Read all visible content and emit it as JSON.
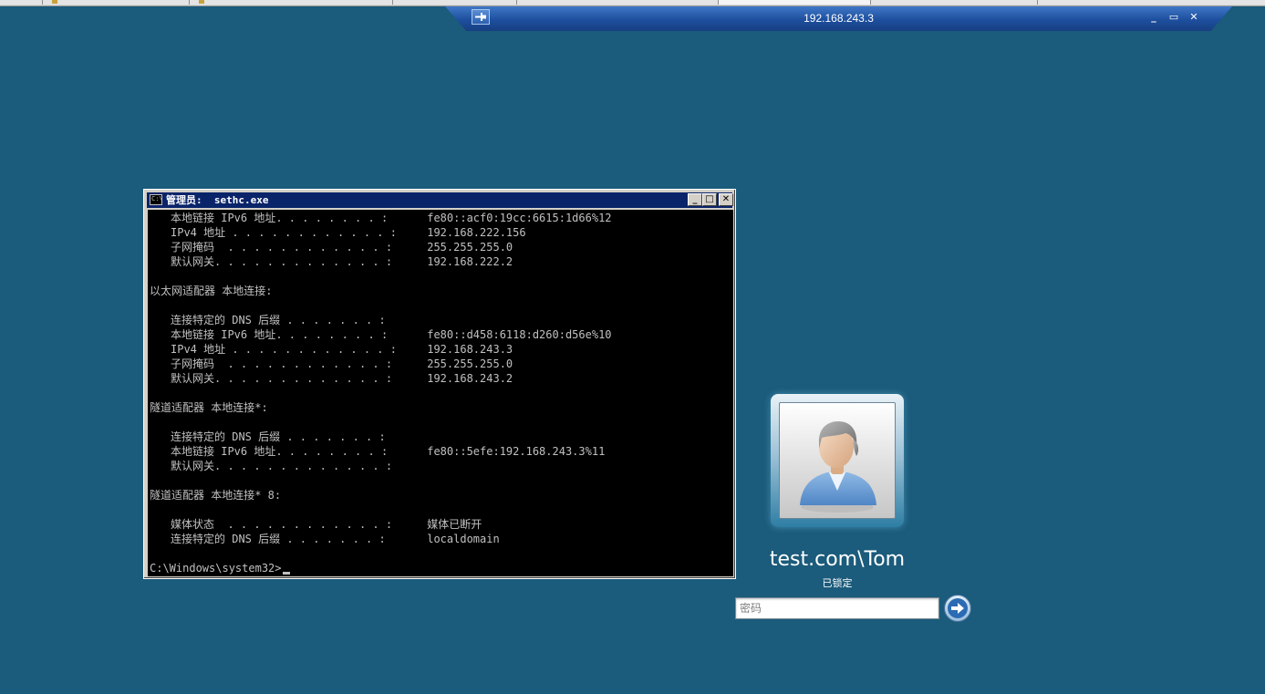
{
  "rdp_bar": {
    "title": "192.168.243.3",
    "pin_icon": "pin-icon",
    "minimize_glyph": "_",
    "restore_glyph": "▭",
    "close_glyph": "✕"
  },
  "cmd_window": {
    "icon_text": "C:\\",
    "title": "管理员:  sethc.exe",
    "minimize_glyph": "_",
    "maximize_glyph": "□",
    "close_glyph": "✕",
    "lines": {
      "l1_label": "本地链接 IPv6 地址. . . . . . . . :",
      "l1_value": "fe80::acf0:19cc:6615:1d66%12",
      "l2_label": "IPv4 地址 . . . . . . . . . . . . :",
      "l2_value": "192.168.222.156",
      "l3_label": "子网掩码  . . . . . . . . . . . . :",
      "l3_value": "255.255.255.0",
      "l4_label": "默认网关. . . . . . . . . . . . . :",
      "l4_value": "192.168.222.2",
      "h2": "以太网适配器 本地连接:",
      "l5_label": "连接特定的 DNS 后缀 . . . . . . . :",
      "l5_value": "",
      "l6_label": "本地链接 IPv6 地址. . . . . . . . :",
      "l6_value": "fe80::d458:6118:d260:d56e%10",
      "l7_label": "IPv4 地址 . . . . . . . . . . . . :",
      "l7_value": "192.168.243.3",
      "l8_label": "子网掩码  . . . . . . . . . . . . :",
      "l8_value": "255.255.255.0",
      "l9_label": "默认网关. . . . . . . . . . . . . :",
      "l9_value": "192.168.243.2",
      "h3": "隧道适配器 本地连接*:",
      "l10_label": "连接特定的 DNS 后缀 . . . . . . . :",
      "l10_value": "",
      "l11_label": "本地链接 IPv6 地址. . . . . . . . :",
      "l11_value": "fe80::5efe:192.168.243.3%11",
      "l12_label": "默认网关. . . . . . . . . . . . . :",
      "l12_value": "",
      "h4": "隧道适配器 本地连接* 8:",
      "l13_label": "媒体状态  . . . . . . . . . . . . :",
      "l13_value": "媒体已断开",
      "l14_label": "连接特定的 DNS 后缀 . . . . . . . :",
      "l14_value": "localdomain",
      "prompt": "C:\\Windows\\system32>"
    }
  },
  "login": {
    "avatar_icon": "user-avatar-icon",
    "username": "test.com\\Tom",
    "status": "已锁定",
    "password_placeholder": "密码",
    "submit_icon": "arrow-right-icon"
  },
  "colors": {
    "desktop": "#1b5b7b",
    "console_bg": "#000000",
    "console_text": "#c0c0c0",
    "titlebar": "#0a246a"
  }
}
